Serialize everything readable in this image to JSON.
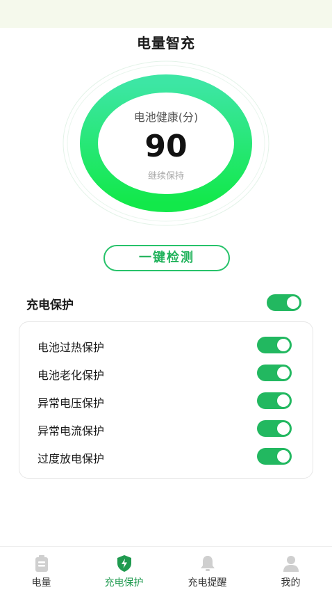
{
  "header": {
    "title": "电量智充"
  },
  "gauge": {
    "label": "电池健康(分)",
    "value": "90",
    "subtext": "继续保持",
    "ring_colors": [
      "#3de6a4",
      "#12e84a"
    ]
  },
  "check_button": {
    "label": "一键检测"
  },
  "protection": {
    "title": "充电保护",
    "enabled": true,
    "items": [
      {
        "label": "电池过热保护",
        "enabled": true
      },
      {
        "label": "电池老化保护",
        "enabled": true
      },
      {
        "label": "异常电压保护",
        "enabled": true
      },
      {
        "label": "异常电流保护",
        "enabled": true
      },
      {
        "label": "过度放电保护",
        "enabled": true
      }
    ]
  },
  "tabbar": {
    "tabs": [
      {
        "label": "电量",
        "icon": "battery-icon",
        "active": false
      },
      {
        "label": "充电保护",
        "icon": "shield-bolt-icon",
        "active": true
      },
      {
        "label": "充电提醒",
        "icon": "bell-icon",
        "active": false
      },
      {
        "label": "我的",
        "icon": "user-icon",
        "active": false
      }
    ]
  },
  "colors": {
    "accent": "#22b860",
    "toggle_on": "#22b860",
    "tab_active": "#1f9a4f"
  }
}
